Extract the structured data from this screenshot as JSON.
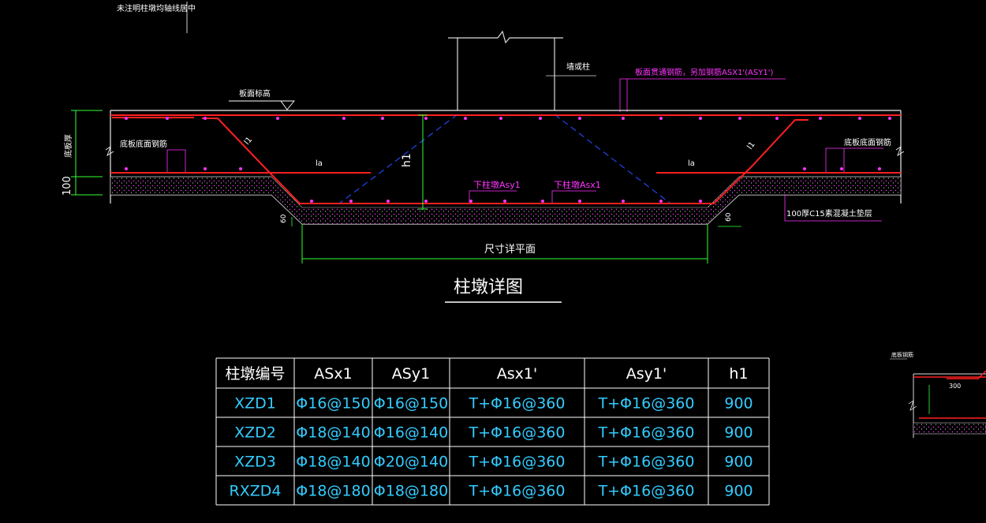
{
  "notes": {
    "top_note": "未注明柱墩均轴线居中",
    "slab_elev": "板面标高",
    "column_label": "墙或柱",
    "top_rebar_note": "板面贯通钢筋，另加钢筋ASX1'(ASY1')",
    "bottom_rebar_left": "底板底面钢筋",
    "bottom_rebar_right": "底板底面钢筋",
    "left_thickness": "底板厚",
    "left_100": "100",
    "la_left": "la",
    "la_right": "la",
    "h1": "h1",
    "rebar_asy1": "下柱墩Asy1",
    "rebar_asx1": "下柱墩Asx1",
    "cushion": "100厚C15素混凝土垫层",
    "dim_60_left": "60",
    "dim_60_right": "60",
    "size_note": "尺寸详平面",
    "detail_title": "柱墩详图",
    "side_label": "底板钢筋",
    "side_dim": "300",
    "slope_left": "l1",
    "slope_right": "l1"
  },
  "table": {
    "headers": [
      "柱墩编号",
      "ASx1",
      "ASy1",
      "Asx1'",
      "Asy1'",
      "h1"
    ],
    "rows": [
      [
        "XZD1",
        "Φ16@150",
        "Φ16@150",
        "T+Φ16@360",
        "T+Φ16@360",
        "900"
      ],
      [
        "XZD2",
        "Φ18@140",
        "Φ16@140",
        "T+Φ16@360",
        "T+Φ16@360",
        "900"
      ],
      [
        "XZD3",
        "Φ18@140",
        "Φ20@140",
        "T+Φ16@360",
        "T+Φ16@360",
        "900"
      ],
      [
        "RXZD4",
        "Φ18@180",
        "Φ18@180",
        "T+Φ16@360",
        "T+Φ16@360",
        "900"
      ]
    ]
  },
  "colors": {
    "background": "#000000",
    "line_white": "#ffffff",
    "rebar_red": "#ff2020",
    "text_magenta": "#ff33ff",
    "dim_green": "#33ff33",
    "dash_blue": "#2244ee",
    "table_cyan": "#33ccff"
  }
}
